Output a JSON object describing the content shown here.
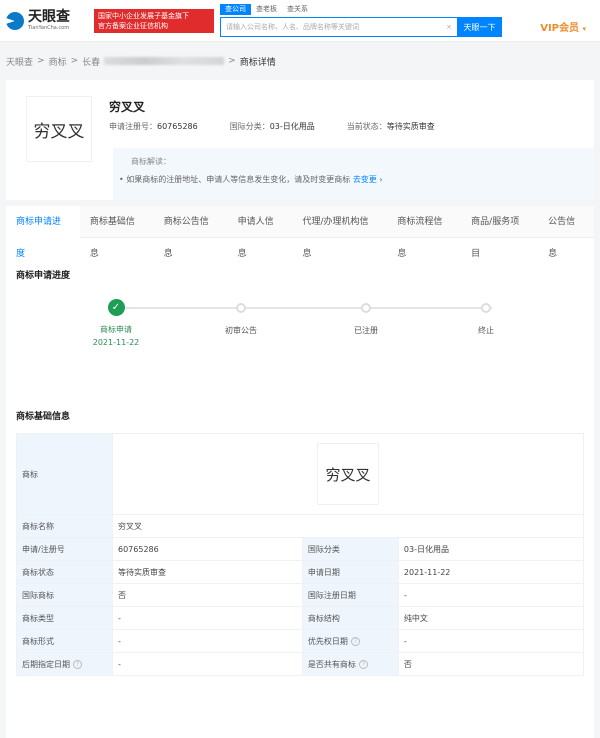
{
  "header": {
    "logo_cn": "天眼查",
    "logo_en": "TianYanCha.com",
    "badge_line1": "国家中小企业发展子基金旗下",
    "badge_line2": "官方备案企业征信机构",
    "search_tabs": [
      "查公司",
      "查老板",
      "查关系"
    ],
    "search_placeholder": "请输入公司名称、人名、品牌名称等关键词",
    "search_clear": "×",
    "search_button": "天眼一下",
    "vip_label": "VIP会员",
    "vip_caret": "▾"
  },
  "breadcrumb": {
    "items": [
      "天眼查",
      "商标",
      "长春"
    ],
    "separator": ">",
    "current": "商标详情"
  },
  "trademark": {
    "image_text": "穷叉叉",
    "name": "穷叉叉",
    "reg_no_label": "申请注册号：",
    "reg_no": "60765286",
    "class_label": "国际分类：",
    "class_value": "03-日化用品",
    "status_label": "当前状态：",
    "status_value": "等待实质审查",
    "interpret_title": "商标解读：",
    "interpret_tip": "• 如果商标的注册地址、申请人等信息发生变化，请及时变更商标",
    "interpret_link": "去变更 ›"
  },
  "tabs": [
    "商标申请进度",
    "商标基础信息",
    "商标公告信息",
    "申请人信息",
    "代理/办理机构信息",
    "商标流程信息",
    "商品/服务项目",
    "公告信息"
  ],
  "progress": {
    "title": "商标申请进度",
    "steps": [
      {
        "label": "商标申请",
        "date": "2021-11-22",
        "done": true
      },
      {
        "label": "初审公告",
        "date": "",
        "done": false
      },
      {
        "label": "已注册",
        "date": "",
        "done": false
      },
      {
        "label": "终止",
        "date": "",
        "done": false
      }
    ],
    "check": "✓"
  },
  "basic_info": {
    "title": "商标基础信息",
    "trademark_label": "商标",
    "trademark_image_text": "穷叉叉",
    "name_label": "商标名称",
    "name_value": "穷叉叉",
    "rows": [
      {
        "l1": "申请/注册号",
        "v1": "60765286",
        "l2": "国际分类",
        "v2": "03-日化用品",
        "h1": false,
        "h2": false
      },
      {
        "l1": "商标状态",
        "v1": "等待实质审查",
        "l2": "申请日期",
        "v2": "2021-11-22",
        "h1": false,
        "h2": false
      },
      {
        "l1": "国际商标",
        "v1": "否",
        "l2": "国际注册日期",
        "v2": "-",
        "h1": false,
        "h2": false
      },
      {
        "l1": "商标类型",
        "v1": "-",
        "l2": "商标结构",
        "v2": "纯中文",
        "h1": false,
        "h2": false
      },
      {
        "l1": "商标形式",
        "v1": "-",
        "l2": "优先权日期",
        "v2": "-",
        "h1": false,
        "h2": true
      },
      {
        "l1": "后期指定日期",
        "v1": "-",
        "l2": "是否共有商标",
        "v2": "否",
        "h1": true,
        "h2": true
      }
    ],
    "help_glyph": "?"
  },
  "colors": {
    "brand_blue": "#0084ff",
    "vip_orange": "#ef8c2e",
    "badge_red": "#e02c2c",
    "done_green": "#1f9d55"
  }
}
